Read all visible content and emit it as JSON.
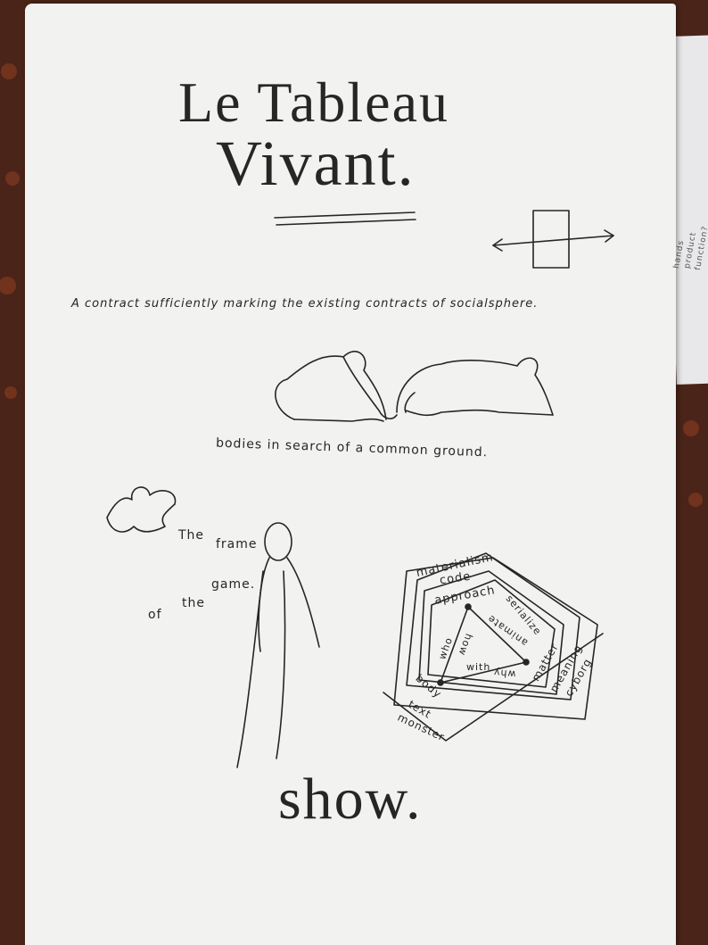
{
  "title_line1": "Le Tableau",
  "title_line2": "Vivant.",
  "contract_line": "A contract sufficiently marking the existing contracts of socialsphere.",
  "bodies_caption": "bodies in search of a common ground.",
  "frame_words": [
    "The",
    "frame",
    "of",
    "the",
    "game."
  ],
  "diagram": {
    "outer_labels": [
      "materialism",
      "code",
      "approach"
    ],
    "inner_labels": [
      "serialize",
      "animate",
      "who",
      "how",
      "with",
      "matter",
      "body",
      "meaning",
      "cyborg",
      "text",
      "monster",
      "why"
    ]
  },
  "closing": "show.",
  "side_note": [
    "hands",
    "product",
    "function?"
  ]
}
